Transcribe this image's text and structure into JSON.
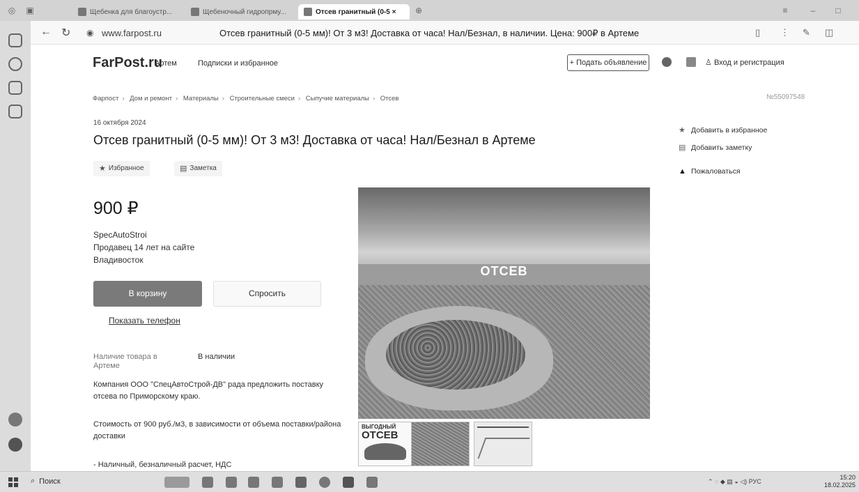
{
  "browser": {
    "tabs": [
      {
        "label": "Щебенка для благоустр..."
      },
      {
        "label": "Щебеночный гидропрму..."
      },
      {
        "label": "Отсев гранитный (0-5 ×"
      }
    ],
    "url": "www.farpost.ru",
    "page_title": "Отсев гранитный (0-5 мм)! От 3 м3! Доставка от часа! Нал/Безнал, в наличии. Цена: 900₽ в Артеме"
  },
  "header": {
    "logo": "FarPost.ru",
    "city": "Артем",
    "subscriptions": "Подписки и избранное",
    "post_ad": "+ Подать объявление",
    "login": "Вход и регистрация"
  },
  "breadcrumbs": [
    "Фарпост",
    "Дом и ремонт",
    "Материалы",
    "Строительные смеси",
    "Сыпучие материалы",
    "Отсев"
  ],
  "ad_number": "№55097548",
  "listing": {
    "date": "16 октября 2024",
    "title": "Отсев гранитный (0-5 мм)! От 3 м3! Доставка от часа! Нал/Безнал в Артеме",
    "fav_chip": "Избранное",
    "note_chip": "Заметка",
    "price": "900 ₽",
    "seller_name": "SpecAutoStroi",
    "seller_since": "Продавец 14 лет на сайте",
    "seller_city": "Владивосток",
    "cart_button": "В корзину",
    "ask_button": "Спросить",
    "show_phone": "Показать телефон",
    "availability_label": "Наличие товара в Артеме",
    "availability_value": "В наличии",
    "desc_1": "Компания ООО \"СпецАвтоСтрой-ДВ\" рада предложить поставку отсева по Приморскому краю.",
    "desc_2": "Стоимость от 900 руб./м3, в зависимости от объема поставки/района доставки",
    "desc_3": "- Наличный, безналичный расчет, НДС"
  },
  "sidebar": {
    "add_favorite": "Добавить в избранное",
    "add_note": "Добавить заметку",
    "complain": "Пожаловаться"
  },
  "photo": {
    "overlay_text": "ОТСЕВ",
    "thumb1_line1": "ВЫГОДНЫЙ",
    "thumb1_line2": "ОТСЕВ"
  },
  "taskbar": {
    "search": "Поиск",
    "lang": "РУС",
    "time": "15:20",
    "date": "18.02.2025"
  },
  "icons": {
    "favorite": "star-icon",
    "note": "note-icon",
    "complain": "warning-icon",
    "user": "user-icon"
  }
}
